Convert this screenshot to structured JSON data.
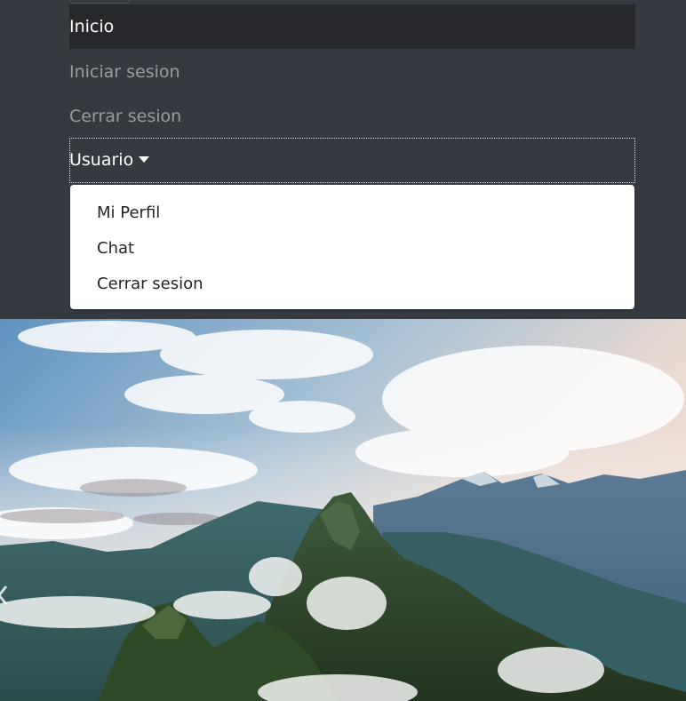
{
  "nav": {
    "items": [
      {
        "label": "Inicio"
      },
      {
        "label": "Iniciar sesion"
      },
      {
        "label": "Cerrar sesion"
      }
    ],
    "user_menu": {
      "label": "Usuario",
      "caret_icon": "caret-down-icon",
      "items": [
        {
          "label": "Mi Perfil"
        },
        {
          "label": "Chat"
        },
        {
          "label": "Cerrar sesion"
        }
      ]
    }
  },
  "carousel": {
    "prev_icon": "chevron-left-icon"
  },
  "colors": {
    "navbar_bg": "#343a40",
    "active_item_bg": "#26282b",
    "muted_text": "#9a9da1",
    "dropdown_bg": "#ffffff",
    "dropdown_text": "#212529"
  }
}
